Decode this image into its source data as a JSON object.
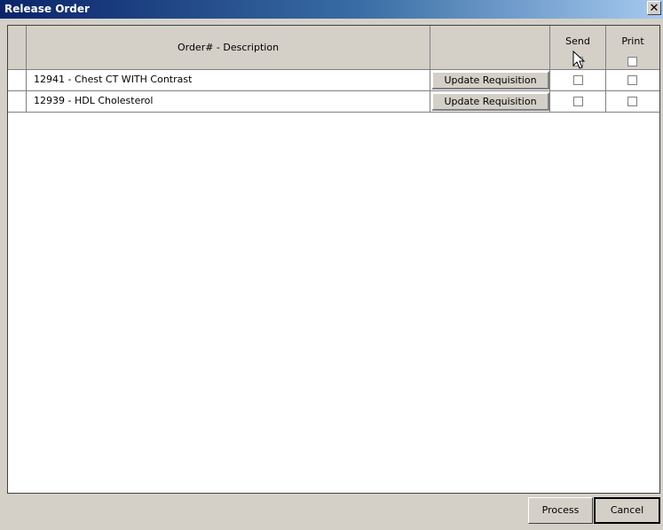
{
  "window": {
    "title": "Release Order",
    "close_icon": "close-icon"
  },
  "grid": {
    "columns": {
      "description": "Order# - Description",
      "send": "Send",
      "print": "Print"
    },
    "rows": [
      {
        "description": "12941 - Chest CT WITH Contrast",
        "button": "Update Requisition",
        "send": false,
        "print": false
      },
      {
        "description": "12939 - HDL Cholesterol",
        "button": "Update Requisition",
        "send": false,
        "print": false
      }
    ]
  },
  "footer": {
    "process_label": "Process",
    "cancel_label": "Cancel"
  }
}
